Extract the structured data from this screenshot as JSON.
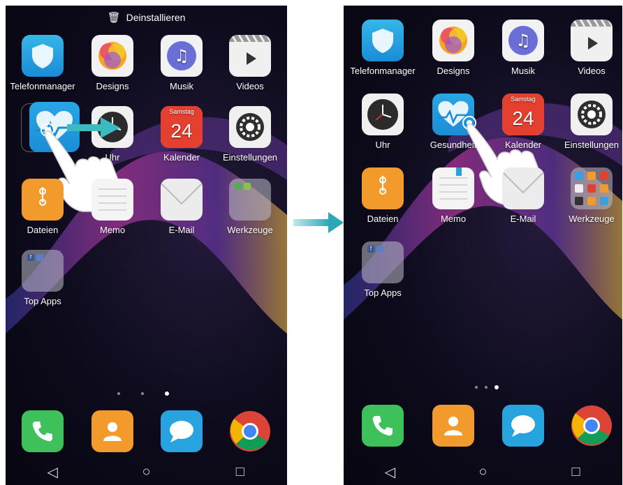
{
  "left_screen": {
    "uninstall_label": "Deinstallieren",
    "apps": [
      {
        "label": "Telefonmanager",
        "icon": "shield-icon"
      },
      {
        "label": "Designs",
        "icon": "designs-icon"
      },
      {
        "label": "Musik",
        "icon": "music-icon"
      },
      {
        "label": "Videos",
        "icon": "video-icon"
      },
      {
        "label": "Uhr",
        "icon": "clock-icon"
      },
      {
        "label": "Kalender",
        "icon": "calendar-icon"
      },
      {
        "label": "Einstellungen",
        "icon": "settings-icon"
      },
      {
        "label": "Dateien",
        "icon": "files-icon"
      },
      {
        "label": "Memo",
        "icon": "memo-icon"
      },
      {
        "label": "E-Mail",
        "icon": "email-icon"
      },
      {
        "label": "Werkzeuge",
        "icon": "folder-icon"
      },
      {
        "label": "Top Apps",
        "icon": "folder-icon"
      }
    ],
    "calendar_day": "Samstag",
    "calendar_date": "24"
  },
  "right_screen": {
    "apps": [
      {
        "label": "Telefonmanager",
        "icon": "shield-icon"
      },
      {
        "label": "Designs",
        "icon": "designs-icon"
      },
      {
        "label": "Musik",
        "icon": "music-icon"
      },
      {
        "label": "Videos",
        "icon": "video-icon"
      },
      {
        "label": "Uhr",
        "icon": "clock-icon"
      },
      {
        "label": "Gesundheit",
        "icon": "health-icon"
      },
      {
        "label": "Kalender",
        "icon": "calendar-icon"
      },
      {
        "label": "Einstellungen",
        "icon": "settings-icon"
      },
      {
        "label": "Dateien",
        "icon": "files-icon"
      },
      {
        "label": "Memo",
        "icon": "memo-icon"
      },
      {
        "label": "E-Mail",
        "icon": "email-icon"
      },
      {
        "label": "Werkzeuge",
        "icon": "folder-icon"
      },
      {
        "label": "Top Apps",
        "icon": "folder-icon"
      }
    ],
    "calendar_day": "Samstag",
    "calendar_date": "24"
  },
  "page_indicator": {
    "count": 3,
    "active_index": 2
  },
  "dock": [
    "phone-icon",
    "contacts-icon",
    "messages-icon",
    "chrome-icon"
  ],
  "colors": {
    "accent": "#2a9fd8",
    "arrow": "#3bbac2",
    "background": "#0d0b1c"
  }
}
